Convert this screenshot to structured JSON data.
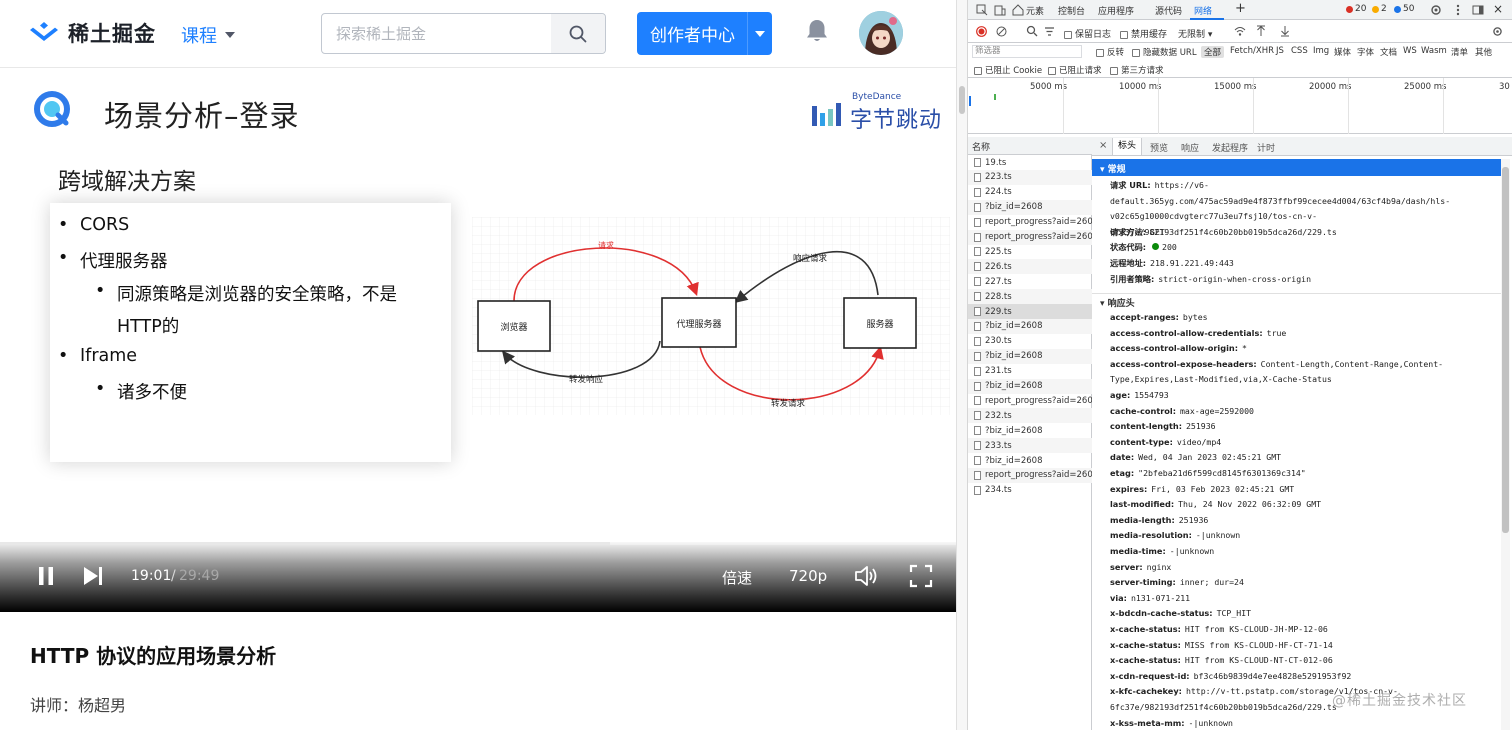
{
  "site": {
    "logo_text": "稀土掘金",
    "nav_course": "课程",
    "search_placeholder": "探索稀土掘金",
    "creator_button": "创作者中心"
  },
  "slide": {
    "title": "场景分析–登录",
    "brand_small": "ByteDance",
    "brand_big": "字节跳动",
    "subtitle": "跨域解决方案",
    "bullets": [
      "CORS",
      "代理服务器",
      "同源策略是浏览器的安全策略，不是",
      "HTTP的",
      "Iframe",
      "诸多不便"
    ],
    "diagram": {
      "browser": "浏览器",
      "proxy": "代理服务器",
      "server": "服务器",
      "request": "请求",
      "response_request": "响应请求",
      "forward_response": "转发响应",
      "forward_request": "转发请求"
    }
  },
  "player": {
    "current_time": "19:01",
    "separator": "/",
    "total_time": "29:49",
    "progress": 0.638,
    "speed": "倍速",
    "quality": "720p"
  },
  "lesson": {
    "title": "HTTP 协议的应用场景分析",
    "teacher": "讲师：杨超男"
  },
  "devtools": {
    "tabs": [
      "元素",
      "控制台",
      "应用程序",
      "源代码",
      "网络"
    ],
    "active_tab": "网络",
    "errors": "20",
    "warnings": "2",
    "infos": "50",
    "toolbar": {
      "preserve_log": "保留日志",
      "disable_cache": "禁用缓存",
      "throttle": "无限制"
    },
    "filter": {
      "placeholder": "筛选器",
      "invert": "反转",
      "hide_data_urls": "隐藏数据 URL",
      "types": [
        "全部",
        "Fetch/XHR",
        "JS",
        "CSS",
        "Img",
        "媒体",
        "字体",
        "文档",
        "WS",
        "Wasm",
        "清单",
        "其他"
      ],
      "blocked_cookies": "已阻止 Cookie",
      "blocked_requests": "已阻止请求",
      "third_party": "第三方请求"
    },
    "timeline_ticks": [
      "5000 ms",
      "10000 ms",
      "15000 ms",
      "20000 ms",
      "25000 ms",
      "30"
    ],
    "list_header": "名称",
    "requests": [
      "19.ts",
      "223.ts",
      "224.ts",
      "?biz_id=2608",
      "report_progress?aid=260…",
      "report_progress?aid=260…",
      "225.ts",
      "226.ts",
      "227.ts",
      "228.ts",
      "229.ts",
      "?biz_id=2608",
      "230.ts",
      "?biz_id=2608",
      "231.ts",
      "?biz_id=2608",
      "report_progress?aid=260…",
      "232.ts",
      "?biz_id=2608",
      "233.ts",
      "?biz_id=2608",
      "report_progress?aid=260…",
      "234.ts"
    ],
    "selected_request": "229.ts",
    "detail_tabs": [
      "标头",
      "预览",
      "响应",
      "发起程序",
      "计时"
    ],
    "general_title": "常规",
    "general": [
      {
        "k": "请求 URL:",
        "v": "https://v6-default.365yg.com/475ac59ad9e4f873ffbf99cecee4d004/63cf4b9a/dash/hls-v02c65g10000cdvgterc77u3eu7fsj10/tos-cn-v-6fc37e/982193df251f4c60b20bb019b5dca26d/229.ts"
      },
      {
        "k": "请求方法:",
        "v": "GET"
      },
      {
        "k": "状态代码:",
        "v": "200"
      },
      {
        "k": "远程地址:",
        "v": "218.91.221.49:443"
      },
      {
        "k": "引用者策略:",
        "v": "strict-origin-when-cross-origin"
      }
    ],
    "response_title": "响应头",
    "response": [
      {
        "k": "accept-ranges:",
        "v": "bytes"
      },
      {
        "k": "access-control-allow-credentials:",
        "v": "true"
      },
      {
        "k": "access-control-allow-origin:",
        "v": "*"
      },
      {
        "k": "access-control-expose-headers:",
        "v": "Content-Length,Content-Range,Content-Type,Expires,Last-Modified,via,X-Cache-Status"
      },
      {
        "k": "age:",
        "v": "1554793"
      },
      {
        "k": "cache-control:",
        "v": "max-age=2592000"
      },
      {
        "k": "content-length:",
        "v": "251936"
      },
      {
        "k": "content-type:",
        "v": "video/mp4"
      },
      {
        "k": "date:",
        "v": "Wed, 04 Jan 2023 02:45:21 GMT"
      },
      {
        "k": "etag:",
        "v": "\"2bfeba21d6f599cd8145f6301369c314\""
      },
      {
        "k": "expires:",
        "v": "Fri, 03 Feb 2023 02:45:21 GMT"
      },
      {
        "k": "last-modified:",
        "v": "Thu, 24 Nov 2022 06:32:09 GMT"
      },
      {
        "k": "media-length:",
        "v": "251936"
      },
      {
        "k": "media-resolution:",
        "v": "-|unknown"
      },
      {
        "k": "media-time:",
        "v": "-|unknown"
      },
      {
        "k": "server:",
        "v": "nginx"
      },
      {
        "k": "server-timing:",
        "v": "inner; dur=24"
      },
      {
        "k": "via:",
        "v": "n131-071-211"
      },
      {
        "k": "x-bdcdn-cache-status:",
        "v": "TCP_HIT"
      },
      {
        "k": "x-cache-status:",
        "v": "HIT from KS-CLOUD-JH-MP-12-06"
      },
      {
        "k": "x-cache-status:",
        "v": "MISS from KS-CLOUD-HF-CT-71-14"
      },
      {
        "k": "x-cache-status:",
        "v": "HIT from KS-CLOUD-NT-CT-012-06"
      },
      {
        "k": "x-cdn-request-id:",
        "v": "bf3c46b9839d4e7ee4828e5291953f92"
      },
      {
        "k": "x-kfc-cachekey:",
        "v": "http://v-tt.pstatp.com/storage/v1/tos-cn-v-6fc37e/982193df251f4c60b20bb019b5dca26d/229.ts"
      },
      {
        "k": "x-kss-meta-mm:",
        "v": "-|unknown"
      }
    ]
  },
  "watermark": "@稀土掘金技术社区",
  "colors": {
    "brand_blue": "#1e80ff",
    "devtools_blue": "#1a73e8",
    "arrow_red": "#e03030"
  }
}
